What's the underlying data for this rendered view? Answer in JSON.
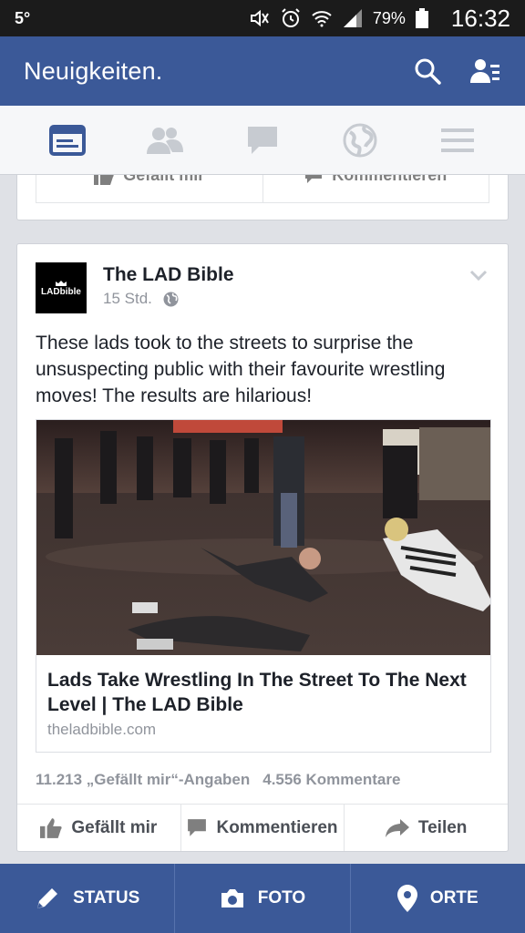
{
  "status_bar": {
    "temperature": "5°",
    "battery_percent": "79%",
    "time": "16:32",
    "icons": [
      "mute-icon",
      "alarm-icon",
      "wifi-icon",
      "signal-icon",
      "battery-icon"
    ]
  },
  "header": {
    "title": "Neuigkeiten.",
    "icons": [
      "search-icon",
      "friend-requests-icon"
    ]
  },
  "tabs": [
    {
      "name": "news-feed",
      "icon": "news-feed-icon",
      "active": true
    },
    {
      "name": "friends",
      "icon": "friends-icon",
      "active": false
    },
    {
      "name": "messages",
      "icon": "messages-icon",
      "active": false
    },
    {
      "name": "notifications",
      "icon": "globe-icon",
      "active": false
    },
    {
      "name": "more",
      "icon": "menu-icon",
      "active": false
    }
  ],
  "previous_post": {
    "like_label": "Gefällt mir",
    "comment_label": "Kommentieren"
  },
  "post": {
    "page_name": "The LAD Bible",
    "avatar_text": "LADbible",
    "time": "15 Std.",
    "text": "These lads took to the streets to surprise the unsuspecting public with their favourite wrestling moves! The results are hilarious!",
    "link": {
      "title": "Lads Take Wrestling In The Street To The Next Level | The LAD Bible",
      "domain": "theladbible.com"
    },
    "likes": "11.213 „Gefällt mir“-Angaben",
    "comments": "4.556 Kommentare",
    "actions": {
      "like": "Gefällt mir",
      "comment": "Kommentieren",
      "share": "Teilen"
    }
  },
  "bottom_bar": {
    "status": "STATUS",
    "photo": "FOTO",
    "places": "ORTE"
  },
  "colors": {
    "brand": "#3b5998",
    "active_tab": "#3b5998",
    "inactive_tab": "#c7cbd1"
  }
}
